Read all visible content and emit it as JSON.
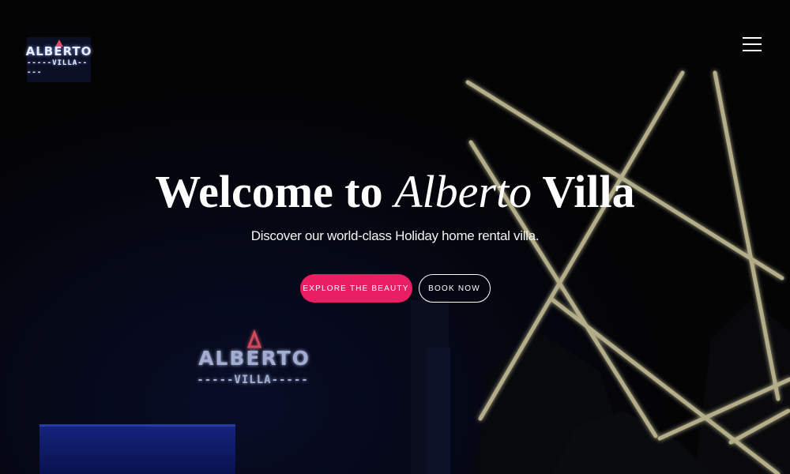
{
  "logo": {
    "main": "ALBERTO",
    "sub": "-----VILLA-----"
  },
  "nav": {
    "menu_icon": "hamburger-menu-icon"
  },
  "hero": {
    "title_prefix": "Welcome to ",
    "title_italic": "Alberto",
    "title_suffix": " Villa",
    "subtitle": "Discover our world-class Holiday home rental villa.",
    "primary_button": "EXPLORE THE BEAUTY",
    "secondary_button": "BOOK NOW"
  },
  "background_sign": {
    "main": "ALBERTO",
    "sub": "-----VILLA-----"
  },
  "colors": {
    "accent": "#e91e63",
    "background": "#050507",
    "neon": "#e8e2b0",
    "sign_blue": "#9fb8ff"
  }
}
